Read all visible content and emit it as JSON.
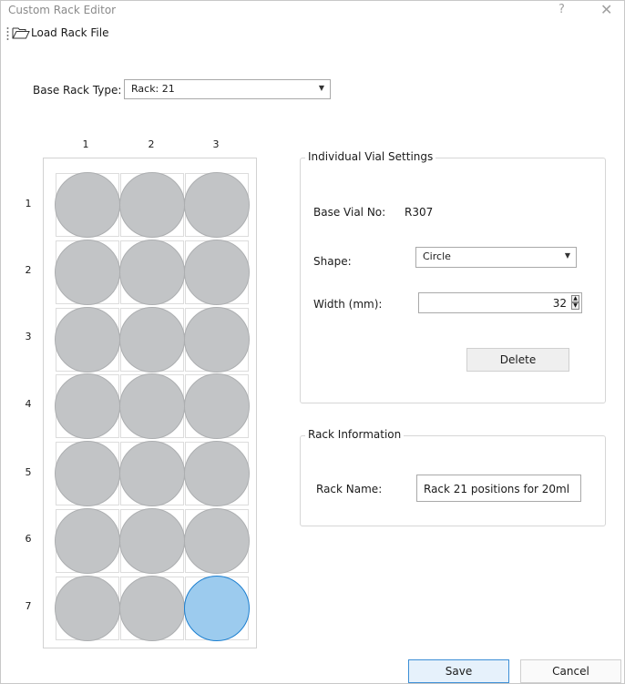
{
  "window": {
    "title": "Custom Rack Editor",
    "help": "?",
    "close": "✕"
  },
  "toolbar": {
    "load_label": "Load Rack File"
  },
  "base_rack": {
    "label": "Base Rack Type:",
    "value": "Rack: 21"
  },
  "grid": {
    "columns": [
      "1",
      "2",
      "3"
    ],
    "rows": [
      "1",
      "2",
      "3",
      "4",
      "5",
      "6",
      "7"
    ],
    "selected": {
      "row": 7,
      "col": 3
    }
  },
  "vial_settings": {
    "title": "Individual Vial Settings",
    "base_vial_label": "Base Vial No:",
    "base_vial_value": "R307",
    "shape_label": "Shape:",
    "shape_value": "Circle",
    "width_label": "Width (mm):",
    "width_value": "32",
    "delete_label": "Delete"
  },
  "rack_info": {
    "title": "Rack Information",
    "name_label": "Rack Name:",
    "name_value": "Rack 21 positions for 20ml"
  },
  "footer": {
    "save_label": "Save",
    "cancel_label": "Cancel"
  },
  "colors": {
    "vial": "#c2c4c6",
    "vial_selected": "#9ccbee",
    "accent": "#1c7fd0"
  }
}
